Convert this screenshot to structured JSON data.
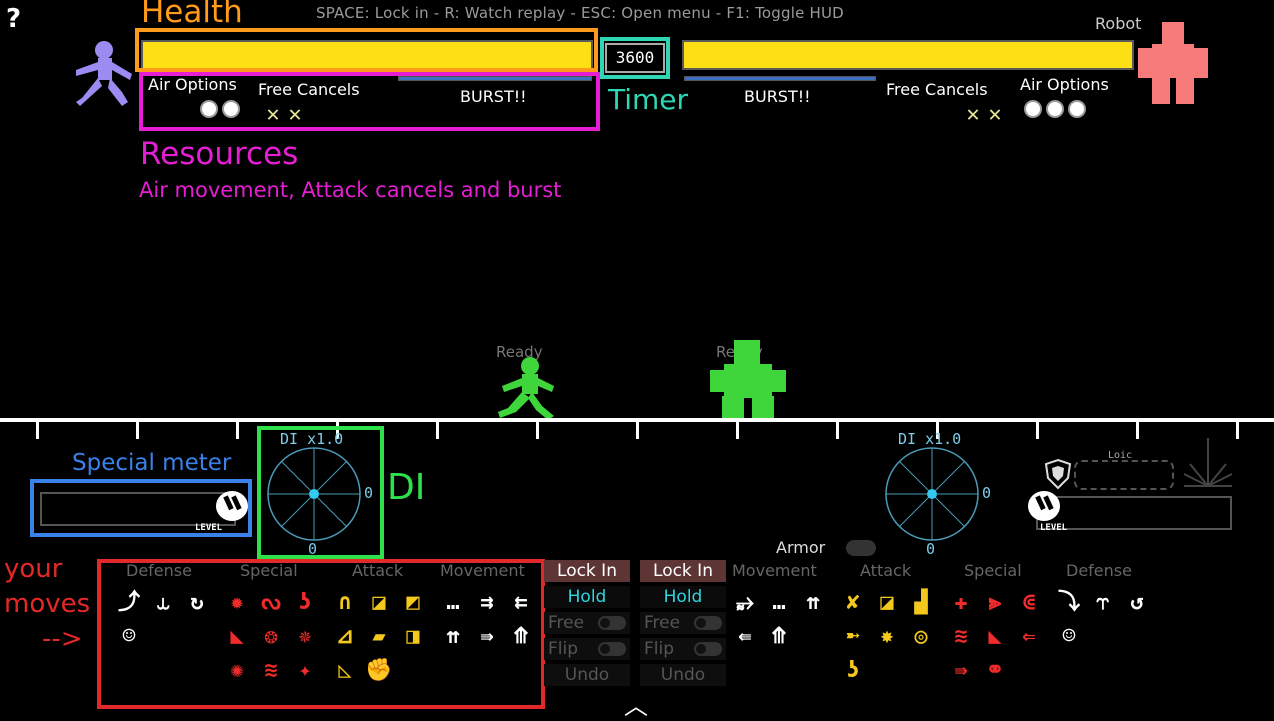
{
  "hud": {
    "help_icon": "?",
    "controls_hint": "SPACE: Lock in - R: Watch replay - ESC: Open menu - F1: Toggle HUD",
    "timer": "3600",
    "p1": {
      "health_fraction": 1.0,
      "air_options_label": "Air Options",
      "air_options_count": 2,
      "free_cancels_label": "Free Cancels",
      "free_cancels_count": 2,
      "burst_label": "BURST!!",
      "color": "#9c8cf2"
    },
    "p2": {
      "name": "Robot",
      "health_fraction": 1.0,
      "air_options_label": "Air Options",
      "air_options_count": 3,
      "free_cancels_label": "Free Cancels",
      "free_cancels_count": 2,
      "burst_label": "BURST!!",
      "color": "#f87b7b"
    }
  },
  "annotations": {
    "health": "Health",
    "timer": "Timer",
    "resources": "Resources",
    "resources_sub": "Air movement, Attack cancels and burst",
    "special_meter": "Special meter",
    "di": "DI",
    "your_moves_1": "your",
    "your_moves_2": "moves",
    "your_moves_arrow": "-->",
    "colors": {
      "health": "#ff9a1a",
      "timer": "#2fd6b4",
      "resources": "#e61ed3",
      "special": "#3a82ea",
      "di": "#2ee04a",
      "moves": "#e22828"
    }
  },
  "arena": {
    "p1_status": "Ready",
    "p2_status": "Ready",
    "fighter_color": "#3ed63a"
  },
  "di": {
    "p1_label": "DI x1.0",
    "p1_x": "0",
    "p1_y": "0",
    "p2_label": "DI x1.0",
    "p2_x": "0",
    "p2_y": "0"
  },
  "meter": {
    "level_tag": "LEVEL",
    "p2_loic": "Loic",
    "armor_label": "Armor"
  },
  "moves_panel": {
    "p1_sections": [
      "Defense",
      "Special",
      "Attack",
      "Movement"
    ],
    "p2_sections": [
      "Movement",
      "Attack",
      "Special",
      "Defense"
    ],
    "lock_in": "Lock In",
    "hold": "Hold",
    "free": "Free",
    "flip": "Flip",
    "undo": "Undo",
    "p1_icons": {
      "defense": [
        "dodge-icon",
        "block-icon",
        "rewind-icon",
        "taunt-icon"
      ],
      "special": [
        "gear-icon",
        "hook-icon",
        "tail-icon",
        "bite-icon",
        "bomb-icon",
        "flame-icon",
        "burst-icon",
        "wave-icon",
        "claw-icon"
      ],
      "attack": [
        "magnet-icon",
        "punch-icon",
        "kick-icon",
        "slide-icon",
        "slash-icon",
        "uppercut-icon",
        "stomp-icon",
        "grab-icon"
      ],
      "movement": [
        "wait-icon",
        "dash-forward-icon",
        "dash-back-icon",
        "jump-icon",
        "run-icon",
        "superjump-icon"
      ]
    },
    "p2_icons": {
      "movement": [
        "bird-icon",
        "wait-icon",
        "jump-icon",
        "dash-back-icon",
        "superjump-icon"
      ],
      "attack": [
        "cross-icon",
        "fist-icon",
        "boot-icon",
        "shock-icon",
        "spark-icon",
        "spiral-icon",
        "hook-icon"
      ],
      "special": [
        "robot-icon",
        "claw-icon",
        "magnet-icon",
        "wave-icon",
        "burst-icon",
        "drill-icon",
        "dash-icon",
        "bike-icon"
      ],
      "defense": [
        "dodge-icon",
        "block-icon",
        "rewind-icon",
        "taunt-icon"
      ]
    }
  }
}
